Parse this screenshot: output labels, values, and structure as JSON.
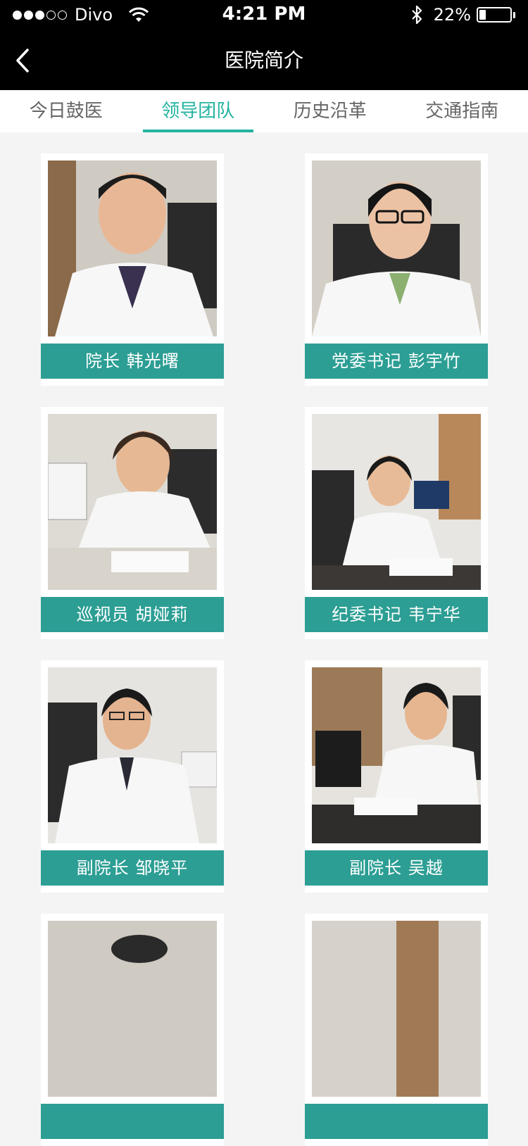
{
  "status_bar": {
    "carrier": "Divo",
    "time": "4:21 PM",
    "battery_percent": "22%",
    "battery_level": 0.22,
    "signal_dots_filled": 3,
    "signal_dots_total": 5
  },
  "nav": {
    "title": "医院简介",
    "back_icon": "chevron-left-icon"
  },
  "tabs": [
    {
      "label": "今日鼓医",
      "active": false
    },
    {
      "label": "领导团队",
      "active": true
    },
    {
      "label": "历史沿革",
      "active": false
    },
    {
      "label": "交通指南",
      "active": false
    }
  ],
  "leaders": [
    {
      "caption": "院长  韩光曙"
    },
    {
      "caption": "党委书记  彭宇竹"
    },
    {
      "caption": "巡视员  胡娅莉"
    },
    {
      "caption": "纪委书记  韦宁华"
    },
    {
      "caption": "副院长  邹晓平"
    },
    {
      "caption": "副院长  吴越"
    },
    {
      "caption": ""
    },
    {
      "caption": ""
    }
  ],
  "colors": {
    "accent": "#23b3a0",
    "caption_bg": "#2c9e94",
    "bar_bg": "#000000",
    "page_bg": "#f4f4f4"
  }
}
